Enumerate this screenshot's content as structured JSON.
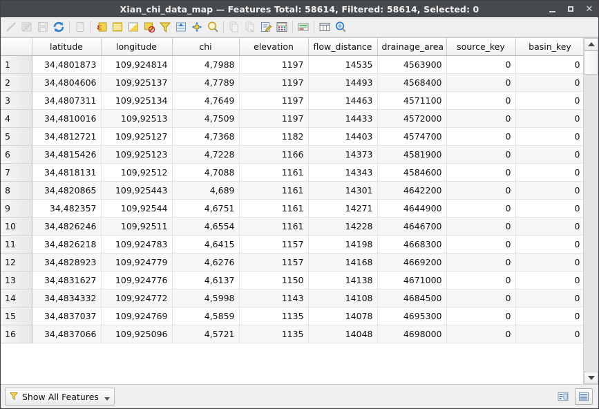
{
  "window": {
    "title": "Xian_chi_data_map — Features Total: 58614, Filtered: 58614, Selected: 0",
    "layer_name": "Xian_chi_data_map",
    "features_total": "58614",
    "features_filtered": "58614",
    "features_selected": "0",
    "minimize_label": "_",
    "maximize_label": "□",
    "close_label": "✕"
  },
  "toolbar": {
    "items": [
      {
        "name": "toggle-editing-icon",
        "tooltip": "Toggle editing mode",
        "enabled": false
      },
      {
        "name": "save-edits-icon",
        "tooltip": "Save edits",
        "enabled": false
      },
      {
        "name": "save-layer-icon",
        "tooltip": "Save layer edits",
        "enabled": false
      },
      {
        "name": "reload-table-icon",
        "tooltip": "Reload the table",
        "enabled": true
      },
      {
        "name": "separator",
        "tooltip": "",
        "enabled": true
      },
      {
        "name": "new-field-icon",
        "tooltip": "New field",
        "enabled": false
      },
      {
        "name": "separator",
        "tooltip": "",
        "enabled": true
      },
      {
        "name": "select-by-expression-icon",
        "tooltip": "Select features using an expression",
        "enabled": true
      },
      {
        "name": "select-all-icon",
        "tooltip": "Select all features",
        "enabled": true
      },
      {
        "name": "invert-selection-icon",
        "tooltip": "Invert selection",
        "enabled": true
      },
      {
        "name": "deselect-all-icon",
        "tooltip": "Deselect all features",
        "enabled": true
      },
      {
        "name": "filter-selection-icon",
        "tooltip": "Filter / select features",
        "enabled": true
      },
      {
        "name": "move-selection-top-icon",
        "tooltip": "Move selection to top",
        "enabled": true
      },
      {
        "name": "pan-map-to-selection-icon",
        "tooltip": "Pan map to selected rows",
        "enabled": true
      },
      {
        "name": "zoom-map-to-selection-icon",
        "tooltip": "Zoom map to selected rows",
        "enabled": true
      },
      {
        "name": "separator",
        "tooltip": "",
        "enabled": true
      },
      {
        "name": "copy-features-icon",
        "tooltip": "Copy selected rows",
        "enabled": false
      },
      {
        "name": "paste-features-icon",
        "tooltip": "Paste features",
        "enabled": false
      },
      {
        "name": "delete-selected-icon",
        "tooltip": "Delete selected features",
        "enabled": true
      },
      {
        "name": "field-calculator-icon",
        "tooltip": "Open field calculator",
        "enabled": true
      },
      {
        "name": "separator",
        "tooltip": "",
        "enabled": true
      },
      {
        "name": "conditional-formatting-icon",
        "tooltip": "Conditional formatting",
        "enabled": true
      },
      {
        "name": "separator",
        "tooltip": "",
        "enabled": true
      },
      {
        "name": "organize-columns-icon",
        "tooltip": "Organize columns",
        "enabled": true
      },
      {
        "name": "actions-icon",
        "tooltip": "Actions",
        "enabled": true
      }
    ]
  },
  "table": {
    "row_header_label": "",
    "columns": [
      "latitude",
      "longitude",
      "chi",
      "elevation",
      "flow_distance",
      "drainage_area",
      "source_key",
      "basin_key"
    ],
    "rows": [
      {
        "id": "1",
        "cells": [
          "34,4801873",
          "109,924814",
          "4,7988",
          "1197",
          "14535",
          "4563900",
          "0",
          "0"
        ]
      },
      {
        "id": "2",
        "cells": [
          "34,4804606",
          "109,925137",
          "4,7789",
          "1197",
          "14493",
          "4568400",
          "0",
          "0"
        ]
      },
      {
        "id": "3",
        "cells": [
          "34,4807311",
          "109,925134",
          "4,7649",
          "1197",
          "14463",
          "4571100",
          "0",
          "0"
        ]
      },
      {
        "id": "4",
        "cells": [
          "34,4810016",
          "109,92513",
          "4,7509",
          "1197",
          "14433",
          "4572000",
          "0",
          "0"
        ]
      },
      {
        "id": "5",
        "cells": [
          "34,4812721",
          "109,925127",
          "4,7368",
          "1182",
          "14403",
          "4574700",
          "0",
          "0"
        ]
      },
      {
        "id": "6",
        "cells": [
          "34,4815426",
          "109,925123",
          "4,7228",
          "1166",
          "14373",
          "4581900",
          "0",
          "0"
        ]
      },
      {
        "id": "7",
        "cells": [
          "34,4818131",
          "109,92512",
          "4,7088",
          "1161",
          "14343",
          "4584600",
          "0",
          "0"
        ]
      },
      {
        "id": "8",
        "cells": [
          "34,4820865",
          "109,925443",
          "4,689",
          "1161",
          "14301",
          "4642200",
          "0",
          "0"
        ]
      },
      {
        "id": "9",
        "cells": [
          "34,482357",
          "109,92544",
          "4,6751",
          "1161",
          "14271",
          "4644900",
          "0",
          "0"
        ]
      },
      {
        "id": "10",
        "cells": [
          "34,4826246",
          "109,92511",
          "4,6554",
          "1161",
          "14228",
          "4646700",
          "0",
          "0"
        ]
      },
      {
        "id": "11",
        "cells": [
          "34,4826218",
          "109,924783",
          "4,6415",
          "1157",
          "14198",
          "4668300",
          "0",
          "0"
        ]
      },
      {
        "id": "12",
        "cells": [
          "34,4828923",
          "109,924779",
          "4,6276",
          "1157",
          "14168",
          "4669200",
          "0",
          "0"
        ]
      },
      {
        "id": "13",
        "cells": [
          "34,4831627",
          "109,924776",
          "4,6137",
          "1150",
          "14138",
          "4671000",
          "0",
          "0"
        ]
      },
      {
        "id": "14",
        "cells": [
          "34,4834332",
          "109,924772",
          "4,5998",
          "1143",
          "14108",
          "4684500",
          "0",
          "0"
        ]
      },
      {
        "id": "15",
        "cells": [
          "34,4837037",
          "109,924769",
          "4,5859",
          "1135",
          "14078",
          "4695300",
          "0",
          "0"
        ]
      },
      {
        "id": "16",
        "cells": [
          "34,4837066",
          "109,925096",
          "4,5721",
          "1135",
          "14048",
          "4698000",
          "0",
          "0"
        ]
      }
    ]
  },
  "statusbar": {
    "filter_label": "Show All Features",
    "filter_icon": "funnel-icon",
    "view_form_icon": "form-view-icon",
    "view_table_icon": "table-view-icon",
    "active_view": "table"
  },
  "colors": {
    "titlebar_bg": "#474a4d",
    "titlebar_text": "#f2f2f2",
    "toolbar_bg": "#efefef",
    "row_alt_bg": "#f7f7f7",
    "row_bg": "#ffffff",
    "header_bg": "#f0f0f0",
    "accent_yellow": "#f2d14b",
    "accent_blue": "#2f7fd1"
  }
}
